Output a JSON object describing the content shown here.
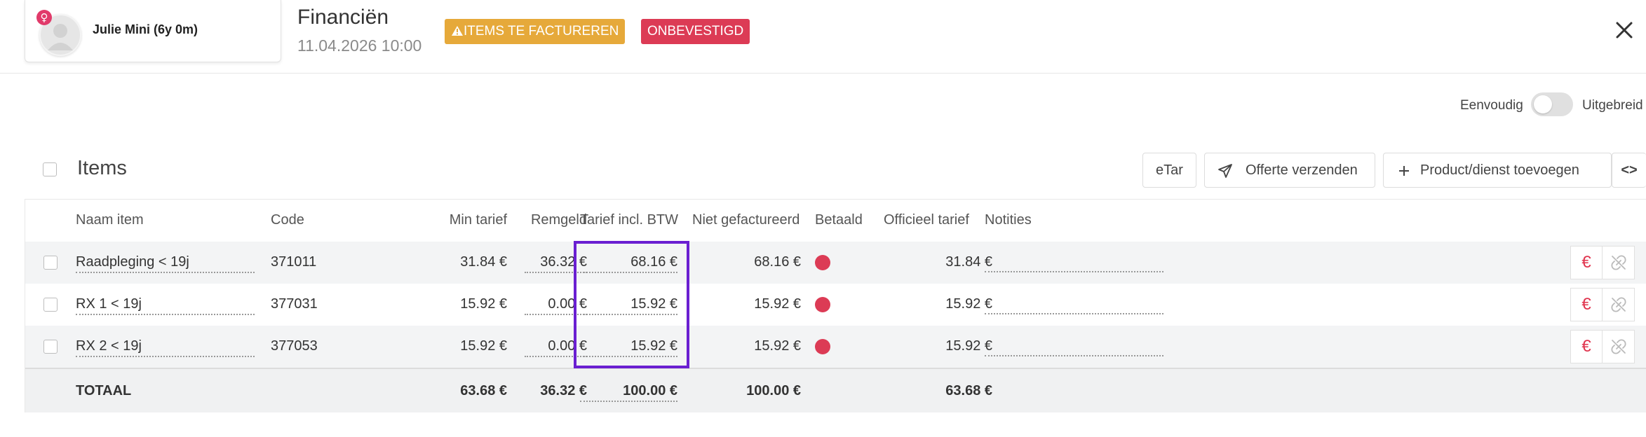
{
  "header": {
    "patient_name": "Julie Mini (6y 0m)",
    "gender_symbol": "♀",
    "title": "Financiën",
    "datetime": "11.04.2026 10:00",
    "badge_warning": "ITEMS TE FACTUREREN",
    "badge_status": "ONBEVESTIGD",
    "colors": {
      "warning": "#e6a93a",
      "status": "#dc3b55",
      "highlight": "#6a1fd1"
    }
  },
  "view_toggle": {
    "left_label": "Eenvoudig",
    "right_label": "Uitgebreid",
    "state": "Eenvoudig"
  },
  "items": {
    "title": "Items",
    "buttons": {
      "etar": "eTar",
      "send_quote": "Offerte verzenden",
      "add_product": "Product/dienst toevoegen",
      "code_toggle": "<>"
    }
  },
  "table": {
    "columns": [
      "Naam item",
      "Code",
      "Min tarief",
      "Remgeld",
      "Tarief incl. BTW",
      "Niet gefactureerd",
      "Betaald",
      "Officieel tarief",
      "Notities"
    ],
    "rows": [
      {
        "name": "Raadpleging < 19j",
        "code": "371011",
        "min_tarief": "31.84 €",
        "remgeld": "36.32 €",
        "tarief_incl_btw": "68.16 €",
        "niet_gefactureerd": "68.16 €",
        "betaald": "unpaid",
        "officieel_tarief": "31.84 €",
        "notities": ""
      },
      {
        "name": "RX 1 < 19j",
        "code": "377031",
        "min_tarief": "15.92 €",
        "remgeld": "0.00 €",
        "tarief_incl_btw": "15.92 €",
        "niet_gefactureerd": "15.92 €",
        "betaald": "unpaid",
        "officieel_tarief": "15.92 €",
        "notities": ""
      },
      {
        "name": "RX 2 < 19j",
        "code": "377053",
        "min_tarief": "15.92 €",
        "remgeld": "0.00 €",
        "tarief_incl_btw": "15.92 €",
        "niet_gefactureerd": "15.92 €",
        "betaald": "unpaid",
        "officieel_tarief": "15.92 €",
        "notities": ""
      }
    ],
    "action_euro": "€",
    "total": {
      "label": "TOTAAL",
      "min_tarief": "63.68 €",
      "remgeld": "36.32 €",
      "tarief_incl_btw": "100.00 €",
      "niet_gefactureerd": "100.00 €",
      "officieel_tarief": "63.68 €"
    }
  }
}
